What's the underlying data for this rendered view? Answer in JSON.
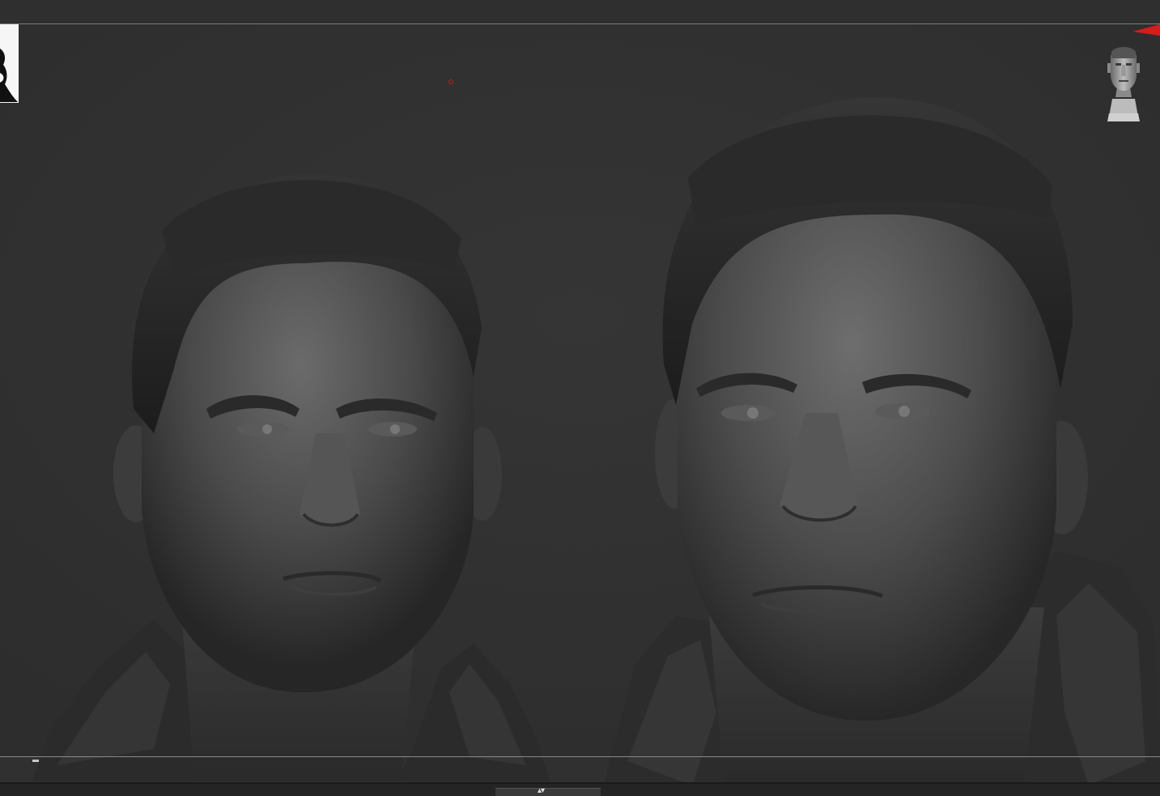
{
  "viewport": {
    "background": "#313131",
    "accent_marker_color": "#d81b1b"
  },
  "icons": {
    "navigation": "navigation-head-icon",
    "pivot": "pivot-point-icon",
    "scroll": "updown-arrows-icon"
  },
  "bottom_handle": {
    "glyph": "▴▾"
  }
}
